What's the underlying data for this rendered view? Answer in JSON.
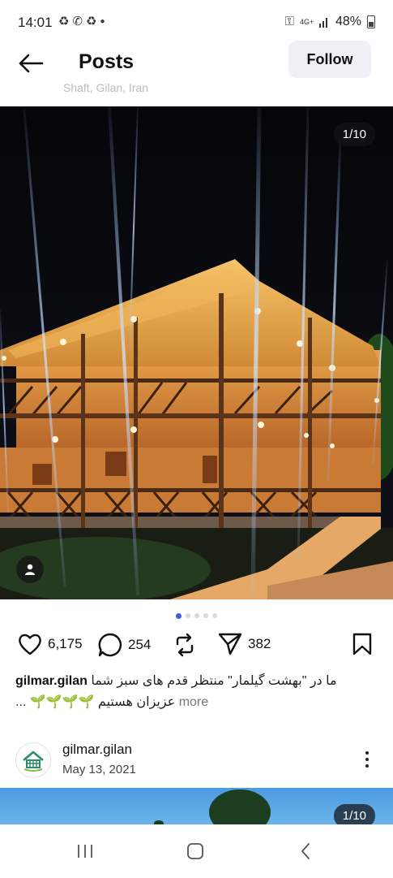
{
  "status_bar": {
    "time": "14:01",
    "battery": "48%",
    "network": "4G+",
    "left_icons": [
      "sync-icon",
      "whatsapp-icon",
      "sync-icon",
      "dot-icon"
    ],
    "right_icons": [
      "key-icon",
      "network-4g-icon",
      "signal-icon",
      "battery-icon"
    ]
  },
  "header": {
    "title": "Posts",
    "follow_label": "Follow",
    "faded_location": "Shaft, Gilan, Iran"
  },
  "post": {
    "image_counter": "1/10",
    "carousel": {
      "total_dots": 5,
      "active_index": 0
    },
    "likes": "6,175",
    "comments": "254",
    "shares": "382",
    "caption_user": "gilmar.gilan",
    "caption_text": "ما در \"بهشت گیلمار\" منتظر قدم های سبز شما",
    "caption_line2": "عزیزان هستیم 🌱🌱🌱🌱 ...",
    "more_label": "more"
  },
  "next_post": {
    "username": "gilmar.gilan",
    "date": "May 13, 2021",
    "image_counter": "1/10"
  },
  "nav": {
    "icons": [
      "recent-apps-icon",
      "home-icon",
      "back-icon"
    ]
  },
  "colors": {
    "accent_dot": "#3f5bd8",
    "follow_bg": "#eef0f3"
  }
}
